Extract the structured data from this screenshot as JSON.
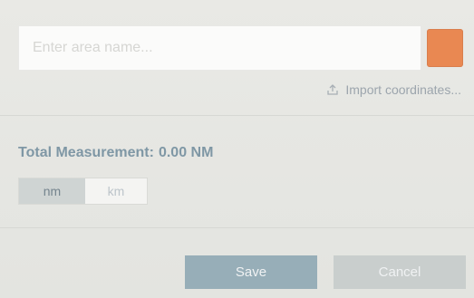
{
  "area_name": {
    "value": "",
    "placeholder": "Enter area name..."
  },
  "color_swatch": {
    "color": "#e98852"
  },
  "import_link": {
    "icon": "upload-icon",
    "label": "Import coordinates..."
  },
  "measurement": {
    "label": "Total Measurement:",
    "value": "0.00 NM"
  },
  "units": {
    "options": [
      "nm",
      "km"
    ],
    "selected": "nm"
  },
  "actions": {
    "save_label": "Save",
    "cancel_label": "Cancel"
  }
}
